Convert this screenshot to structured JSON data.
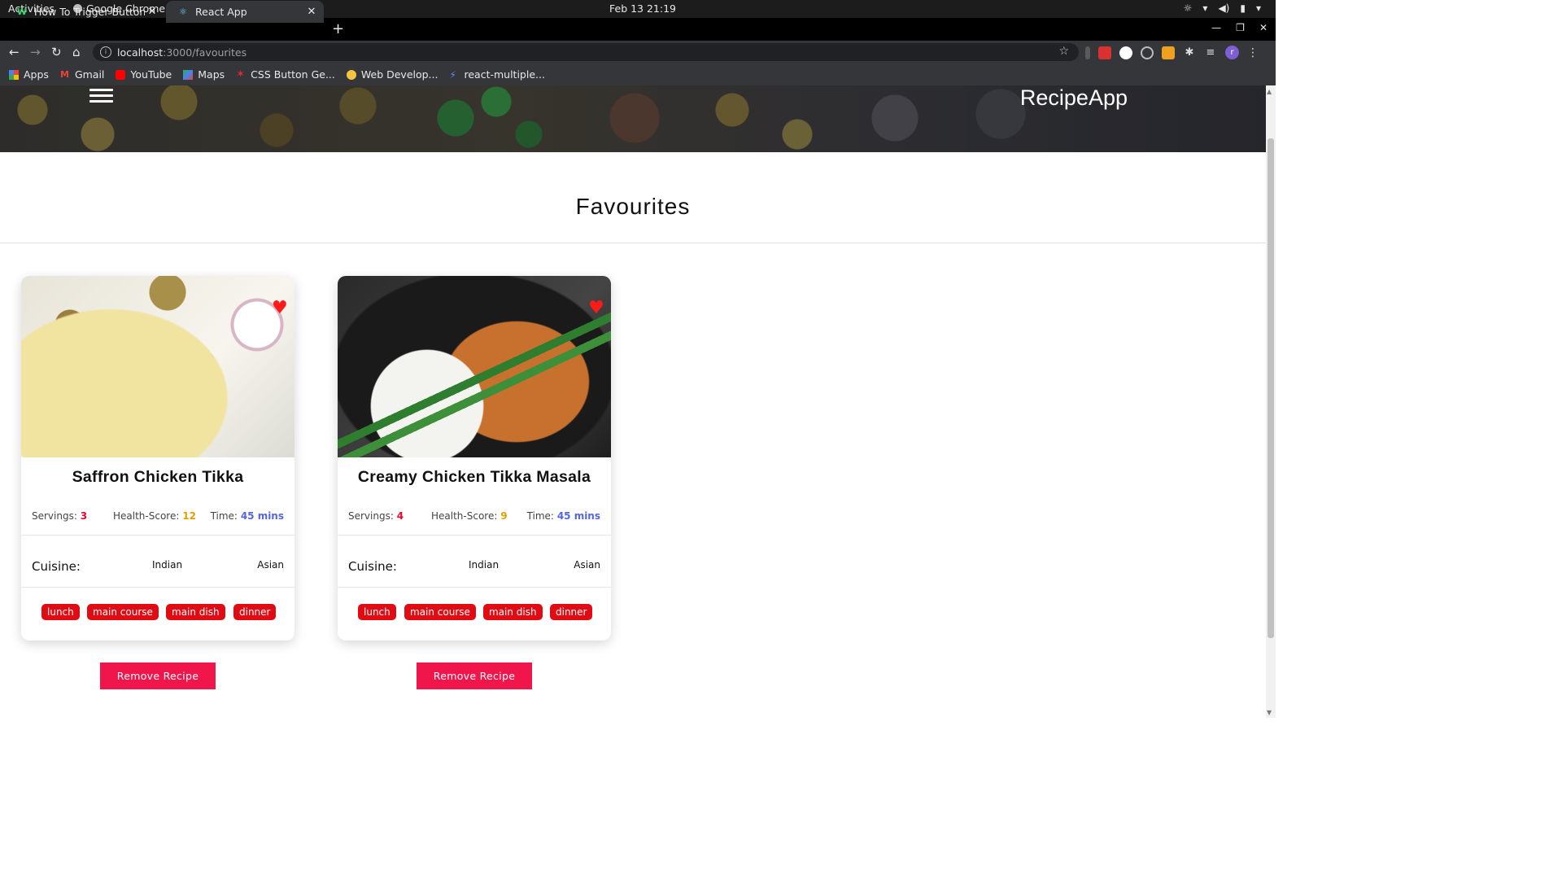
{
  "os": {
    "activities": "Activities",
    "app_name": "Google Chrome",
    "clock": "Feb 13  21:19"
  },
  "tabs": [
    {
      "label": "How To Trigger Button Cl",
      "active": false
    },
    {
      "label": "React App",
      "active": true
    }
  ],
  "address": {
    "host": "localhost",
    "path": ":3000/favourites"
  },
  "profile_initial": "r",
  "bookmarks": [
    {
      "label": "Apps",
      "icon": "apps-grid-icon"
    },
    {
      "label": "Gmail",
      "icon": "gmail-icon"
    },
    {
      "label": "YouTube",
      "icon": "youtube-icon"
    },
    {
      "label": "Maps",
      "icon": "maps-icon"
    },
    {
      "label": "CSS Button Ge...",
      "icon": "css-star-icon"
    },
    {
      "label": "Web Develop...",
      "icon": "web-dev-icon"
    },
    {
      "label": "react-multiple...",
      "icon": "lightning-icon"
    }
  ],
  "header": {
    "brand": "RecipeApp"
  },
  "page_title": "Favourites",
  "cards": [
    {
      "title": "Saffron Chicken Tikka",
      "servings_label": "Servings:",
      "servings": "3",
      "health_label": "Health-Score:",
      "health": "12",
      "time_label": "Time:",
      "time": "45 mins",
      "cuisine_label": "Cuisine:",
      "cuisines": [
        "Indian",
        "Asian"
      ],
      "tags": [
        "lunch",
        "main course",
        "main dish",
        "dinner"
      ],
      "remove_label": "Remove Recipe"
    },
    {
      "title": "Creamy Chicken Tikka Masala",
      "servings_label": "Servings:",
      "servings": "4",
      "health_label": "Health-Score:",
      "health": "9",
      "time_label": "Time:",
      "time": "45 mins",
      "cuisine_label": "Cuisine:",
      "cuisines": [
        "Indian",
        "Asian"
      ],
      "tags": [
        "lunch",
        "main course",
        "main dish",
        "dinner"
      ],
      "remove_label": "Remove Recipe"
    }
  ],
  "colors": {
    "tag_red": "#e10b13",
    "remove_button": "#f0164b",
    "heart": "#ff1a1a",
    "time_blue": "#5566e0",
    "health_amber": "#e0a100"
  }
}
